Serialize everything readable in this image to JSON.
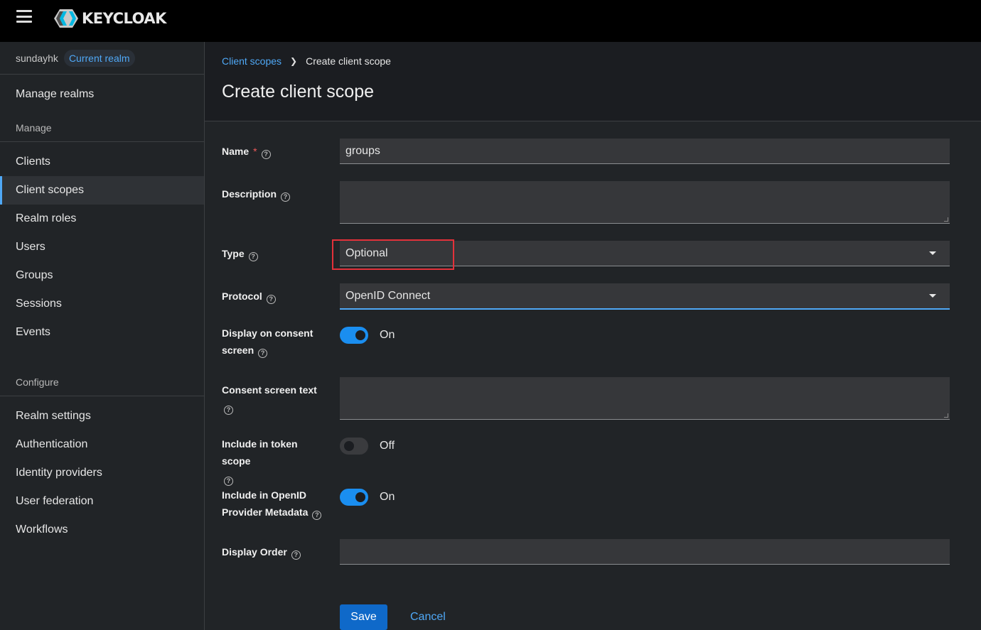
{
  "header": {
    "logo_text": "KEYCLOAK"
  },
  "sidebar": {
    "realm_name": "sundayhk",
    "realm_badge": "Current realm",
    "manage_realms": "Manage realms",
    "manage_section": "Manage",
    "manage_items": [
      {
        "label": "Clients"
      },
      {
        "label": "Client scopes"
      },
      {
        "label": "Realm roles"
      },
      {
        "label": "Users"
      },
      {
        "label": "Groups"
      },
      {
        "label": "Sessions"
      },
      {
        "label": "Events"
      }
    ],
    "configure_section": "Configure",
    "configure_items": [
      {
        "label": "Realm settings"
      },
      {
        "label": "Authentication"
      },
      {
        "label": "Identity providers"
      },
      {
        "label": "User federation"
      },
      {
        "label": "Workflows"
      }
    ]
  },
  "breadcrumb": {
    "parent": "Client scopes",
    "current": "Create client scope"
  },
  "page": {
    "title": "Create client scope"
  },
  "form": {
    "name_label": "Name",
    "name_required": "*",
    "name_value": "groups",
    "description_label": "Description",
    "description_value": "",
    "type_label": "Type",
    "type_value": "Optional",
    "protocol_label": "Protocol",
    "protocol_value": "OpenID Connect",
    "consent_label_1": "Display on consent",
    "consent_label_2": "screen",
    "consent_state": "On",
    "consent_text_label": "Consent screen text",
    "consent_text_value": "",
    "token_scope_label": "Include in token scope",
    "token_scope_state": "Off",
    "openid_meta_label_1": "Include in OpenID",
    "openid_meta_label_2": "Provider Metadata",
    "openid_meta_state": "On",
    "display_order_label": "Display Order",
    "display_order_value": "",
    "help_glyph": "?",
    "save_label": "Save",
    "cancel_label": "Cancel"
  }
}
